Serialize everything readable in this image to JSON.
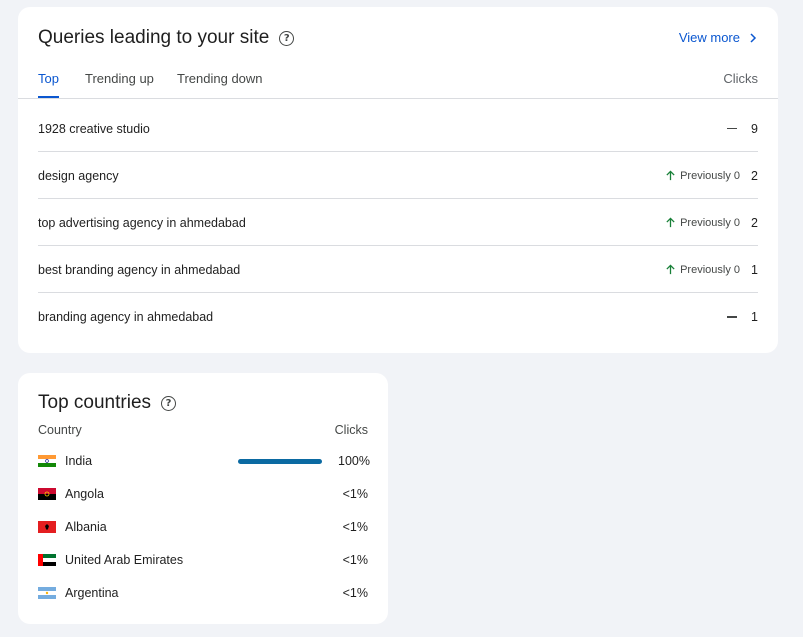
{
  "queries": {
    "title": "Queries leading to your site",
    "view_more": "View more",
    "tabs": [
      "Top",
      "Trending up",
      "Trending down"
    ],
    "clicks_header": "Clicks",
    "rows": [
      {
        "query": "1928 creative studio",
        "trend": "none",
        "trend_text": "",
        "clicks": "9"
      },
      {
        "query": "design agency",
        "trend": "up",
        "trend_text": "Previously 0",
        "clicks": "2"
      },
      {
        "query": "top advertising agency in ahmedabad",
        "trend": "up",
        "trend_text": "Previously 0",
        "clicks": "2"
      },
      {
        "query": "best branding agency in ahmedabad",
        "trend": "up",
        "trend_text": "Previously 0",
        "clicks": "1"
      },
      {
        "query": "branding agency in ahmedabad",
        "trend": "none",
        "trend_text": "",
        "clicks": "1"
      }
    ]
  },
  "countries": {
    "title": "Top countries",
    "col_country": "Country",
    "col_clicks": "Clicks",
    "rows": [
      {
        "name": "India",
        "pct": "100%",
        "share": 1.0,
        "flag": "india-flag"
      },
      {
        "name": "Angola",
        "pct": "<1%",
        "share": 0,
        "flag": "angola-flag"
      },
      {
        "name": "Albania",
        "pct": "<1%",
        "share": 0,
        "flag": "albania-flag"
      },
      {
        "name": "United Arab Emirates",
        "pct": "<1%",
        "share": 0,
        "flag": "uae-flag"
      },
      {
        "name": "Argentina",
        "pct": "<1%",
        "share": 0,
        "flag": "argentina-flag"
      }
    ]
  },
  "colors": {
    "accent": "#0b57d0",
    "bar": "#0b6aa2",
    "trend_up": "#188038",
    "background": "#f1f3f7"
  }
}
